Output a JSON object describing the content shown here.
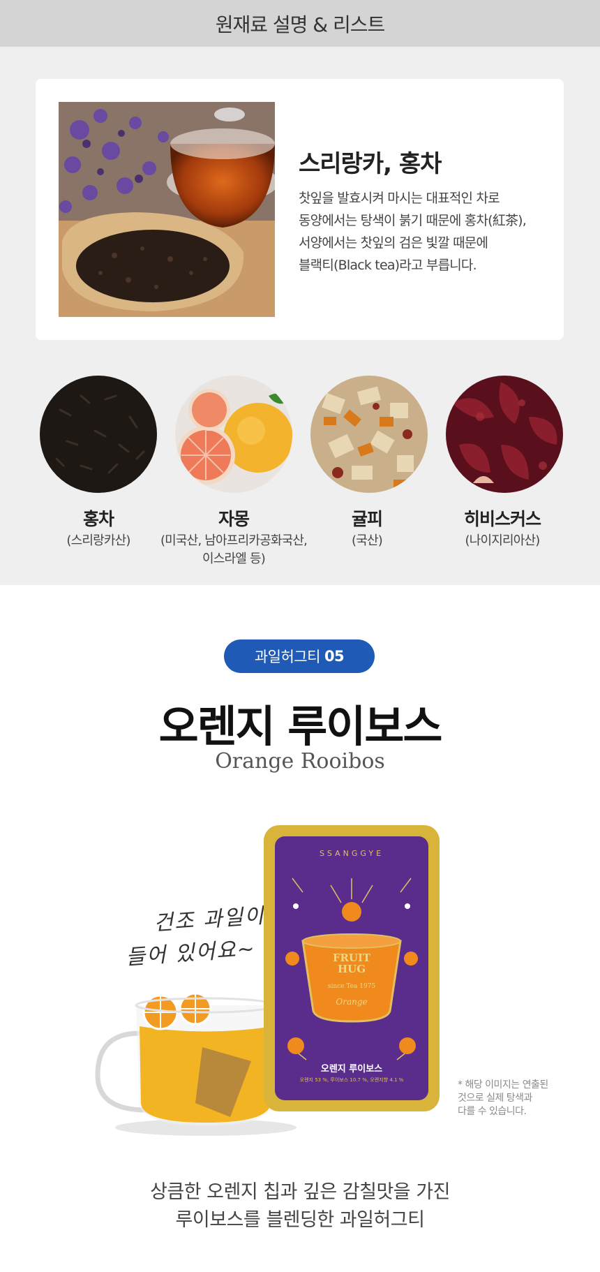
{
  "section_header": "원재료 설명 & 리스트",
  "feature": {
    "title": "스리랑카, 홍차",
    "description": "찻잎을 발효시켜 마시는 대표적인 차로\n동양에서는 탕색이 붉기 때문에 홍차(紅茶),\n서양에서는 찻잎의 검은 빛깔 때문에\n블랙티(Black tea)라고 부릅니다."
  },
  "ingredients": [
    {
      "name": "홍차",
      "origin": "(스리랑카산)",
      "icon": "black-tea-leaves"
    },
    {
      "name": "자몽",
      "origin": "(미국산, 남아프리카공화국산,\n이스라엘 등)",
      "icon": "grapefruit"
    },
    {
      "name": "귤피",
      "origin": "(국산)",
      "icon": "dried-citrus-peel"
    },
    {
      "name": "히비스커스",
      "origin": "(나이지리아산)",
      "icon": "dried-hibiscus"
    }
  ],
  "product": {
    "badge_label": "과일허그티",
    "badge_number": "05",
    "title_ko": "오렌지 루이보스",
    "title_en": "Orange Rooibos",
    "handwriting_line1": "건조 과일이",
    "handwriting_line2": "들어 있어요~",
    "tin_brand": "SSANGGYE",
    "tin_logo_line1": "FRUIT",
    "tin_logo_line2": "HUG",
    "tin_since": "since  Tea  1975",
    "tin_flavor": "Orange",
    "tin_name": "오렌지 루이보스",
    "tin_ingredients": "오렌지 53 %, 루이보스 10.7 %, 오렌지향 4.1 %",
    "image_note": "* 해당 이미지는 연출된\n것으로 실제 탕색과\n다를 수 있습니다.",
    "footer_text": "상큼한 오렌지 칩과 깊은 감칠맛을 가진\n루이보스를 블렌딩한 과일허그티"
  },
  "colors": {
    "header_bg": "#d4d4d4",
    "panel_bg": "#efefef",
    "badge_bg": "#1f5bb6",
    "tin_purple": "#5a2d8c",
    "tin_gold": "#d8b43a",
    "orange": "#f08a1c"
  }
}
